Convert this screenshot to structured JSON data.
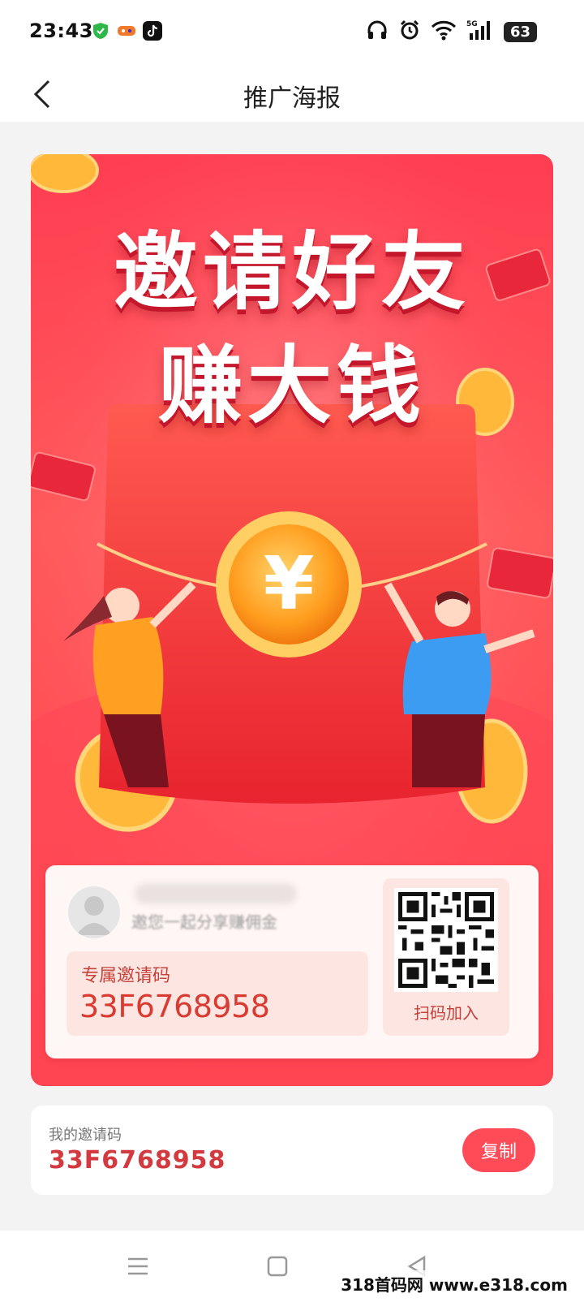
{
  "status_bar": {
    "time": "23:43",
    "battery": "63",
    "network": "5G"
  },
  "nav": {
    "title": "推广海报"
  },
  "poster": {
    "headline_line1": "邀请好友",
    "headline_line2": "赚大钱",
    "coin_symbol": "¥",
    "invite_slogan": "邀您一起分享赚佣金",
    "code_label": "专属邀请码",
    "code_value": "33F6768958",
    "qr_label": "扫码加入"
  },
  "my_code": {
    "label": "我的邀请码",
    "value": "33F6768958",
    "copy_label": "复制"
  },
  "watermark": "318首码网 www.e318.com",
  "colors": {
    "primary": "#ff4a58",
    "poster_red": "#ff3d52",
    "code_text": "#d93b32"
  }
}
